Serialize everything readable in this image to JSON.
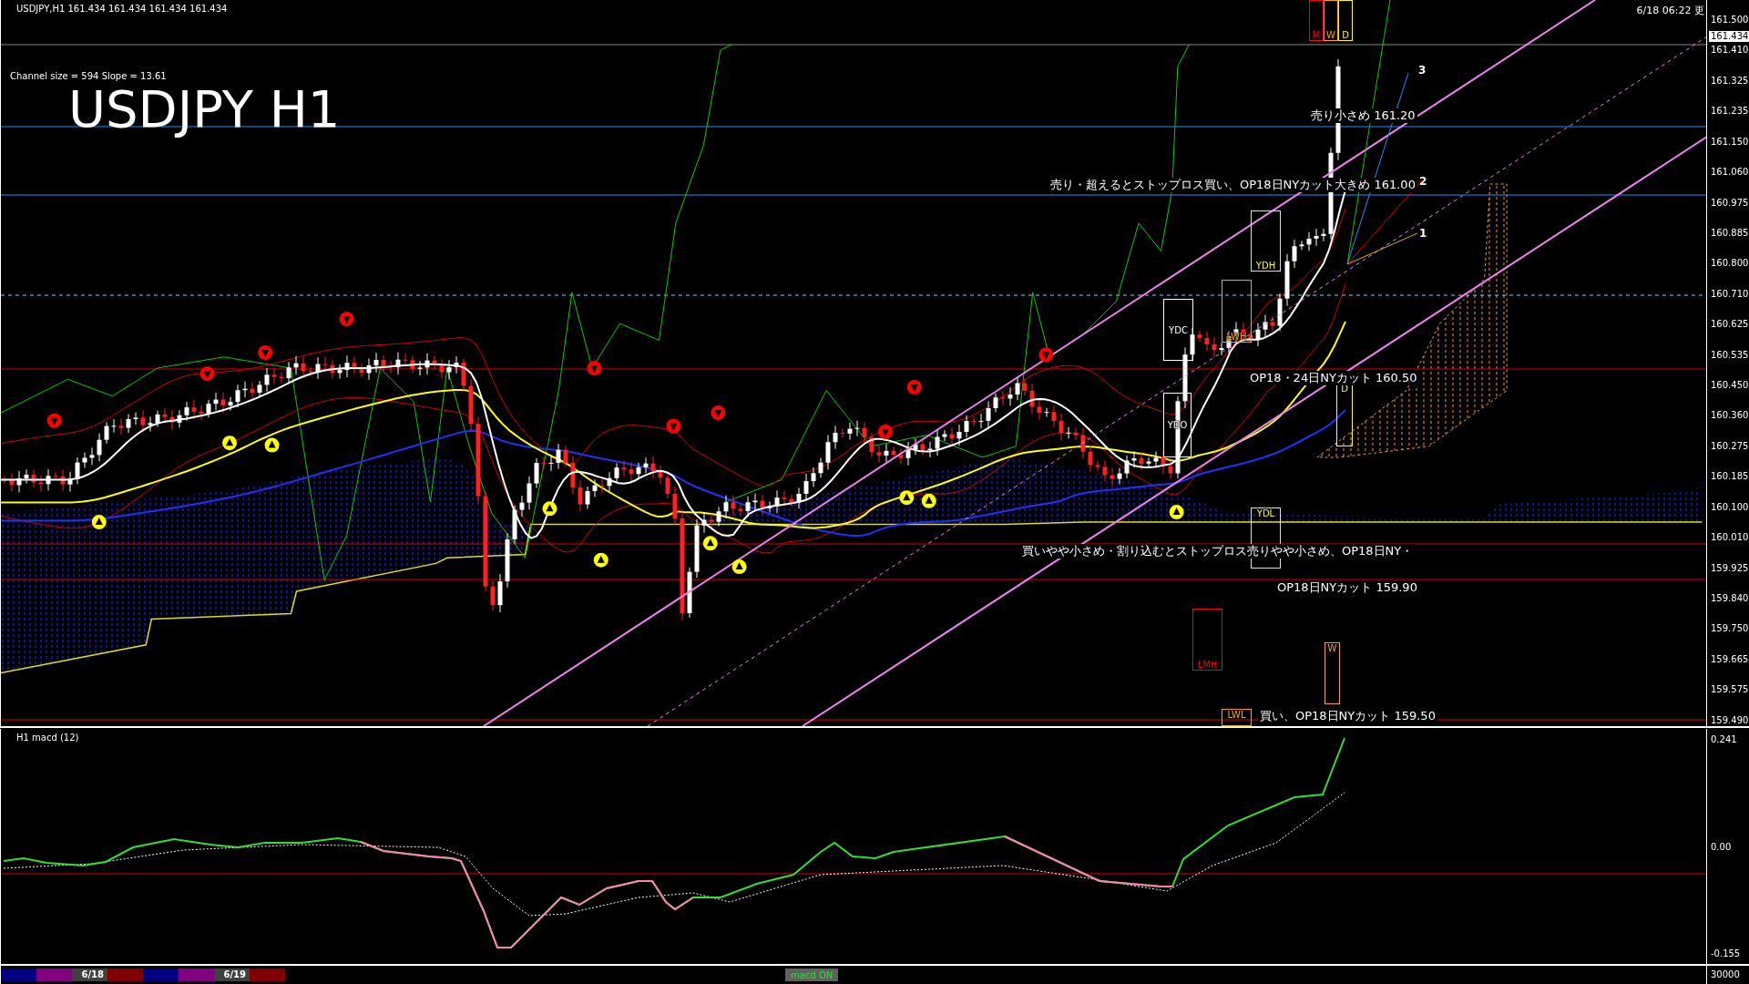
{
  "chart": {
    "header": "USDJPY,H1  161.434 161.434 161.434 161.434",
    "channel_info": "Channel size = 594 Slope = 13.61",
    "title": "USDJPY H1",
    "updated": "6/18 06:22 更",
    "current_price": "161.434",
    "price_axis": [
      "161.500",
      "161.410",
      "161.325",
      "161.235",
      "161.150",
      "161.060",
      "160.975",
      "160.885",
      "160.800",
      "160.710",
      "160.625",
      "160.535",
      "160.450",
      "160.360",
      "160.275",
      "160.185",
      "160.100",
      "160.010",
      "159.925",
      "159.840",
      "159.750",
      "159.665",
      "159.575",
      "159.490"
    ],
    "annotations": [
      {
        "text": "売り小さめ 161.20"
      },
      {
        "text": "売り・超えるとストップロス買い、OP18日NYカット大きめ 161.00"
      },
      {
        "text": "OP18・24日NYカット 160.50"
      },
      {
        "text": "買いやや小さめ・割り込むとストップロス売りやや小さめ、OP18日NY・"
      },
      {
        "text": "OP18日NYカット 159.90"
      },
      {
        "text": "買い、OP18日NYカット 159.50"
      }
    ],
    "channel_labels": [
      "3",
      "2",
      "1"
    ],
    "level_boxes": [
      {
        "label": "M",
        "color": "#ff0000"
      },
      {
        "label": "W",
        "color": "#ffa500"
      },
      {
        "label": "D",
        "color": "#ffff00"
      },
      {
        "label": "YDH",
        "color": "#ffff00"
      },
      {
        "label": "YDC",
        "color": "#ffffff"
      },
      {
        "label": "LWH",
        "color": "#ffa500"
      },
      {
        "label": "YDO",
        "color": "#ffffff"
      },
      {
        "label": "D",
        "color": "#ffff00"
      },
      {
        "label": "YDL",
        "color": "#ffff00"
      },
      {
        "label": "LMH",
        "color": "#ff0000"
      },
      {
        "label": "W",
        "color": "#ffa500"
      },
      {
        "label": "LWL",
        "color": "#ffa500"
      }
    ]
  },
  "macd": {
    "title": "H1  macd (12)",
    "axis": [
      "0.241",
      "0.00",
      "-0.155"
    ]
  },
  "bottom_bar": {
    "segments": [
      {
        "color": "#000080"
      },
      {
        "color": "#800080"
      },
      {
        "label": "6/18",
        "color": "#404040"
      },
      {
        "color": "#800000"
      },
      {
        "color": "#000080"
      },
      {
        "color": "#800080"
      },
      {
        "label": "6/19",
        "color": "#404040"
      },
      {
        "color": "#800000"
      }
    ],
    "indicator": "macd ON",
    "volume_scale": "30000"
  }
}
